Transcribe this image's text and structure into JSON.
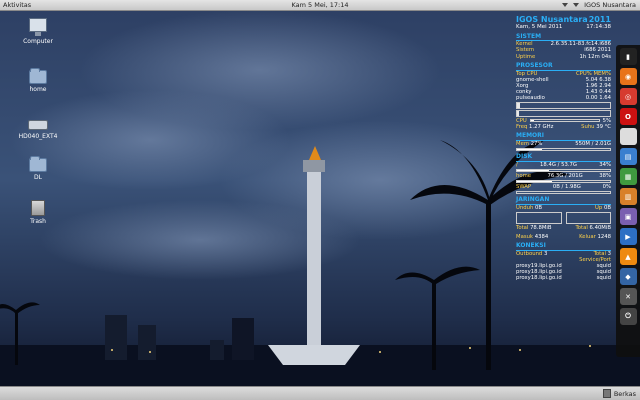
{
  "top_panel": {
    "menu_label": "Aktivitas",
    "clock": "Kam 5 Mei, 17:14",
    "user": "IGOS Nusantara"
  },
  "desktop_icons": [
    {
      "label": "Computer",
      "icon": "computer-icon"
    },
    {
      "label": "home",
      "icon": "folder-home-icon"
    },
    {
      "label": "HD040_EXT4",
      "icon": "drive-icon"
    },
    {
      "label": "DL",
      "icon": "folder-icon"
    },
    {
      "label": "Trash",
      "icon": "trash-icon"
    }
  ],
  "conky": {
    "title": "IGOS Nusantara",
    "year": "2011",
    "date": "Kam, 5 Mei 2011",
    "time": "17:14:38",
    "sistem_label": "SISTEM",
    "sistem": [
      {
        "k": "Kernel",
        "v": "2.6.35.11-83.fc14.i686"
      },
      {
        "k": "Sistem",
        "v": "i686 2011"
      },
      {
        "k": "Uptime",
        "v": "1h 12m 04s"
      }
    ],
    "prosesor_label": "PROSESOR",
    "proc_header": [
      "Top CPU",
      "CPU% MEM%"
    ],
    "procs": [
      {
        "k": "gnome-shell",
        "v": "5.04  6.38"
      },
      {
        "k": "Xorg",
        "v": "1.96  2.94"
      },
      {
        "k": "conky",
        "v": "1.43  0.44"
      },
      {
        "k": "pulseaudio",
        "v": "0.00  1.64"
      }
    ],
    "cpu_percent": 5,
    "cpu_label": "CPU",
    "cpu_value": "5%",
    "freq_label": "Freq",
    "freq_value": "1.27 GHz",
    "suhu_label": "Suhu",
    "suhu_value": "39 °C",
    "memori_label": "MEMORI",
    "mem_label": "Mem",
    "mem_percent_text": "27%",
    "mem_value": "550M / 2.01G",
    "mem_percent": 27,
    "disk_label": "DISK",
    "disks": [
      {
        "k": "/",
        "v": "18.4G / 53.7G",
        "pct": "34%",
        "fill": 34
      },
      {
        "k": "home",
        "v": "76.3G / 201G",
        "pct": "38%",
        "fill": 38
      },
      {
        "k": "SWAP",
        "v": "0B / 1.98G",
        "pct": "0%",
        "fill": 0
      }
    ],
    "jaringan_label": "JARINGAN",
    "down_label": "Unduh",
    "down_value": "0B",
    "up_label": "Up",
    "up_value": "0B",
    "total_down_label": "Total",
    "total_down": "78.8MiB",
    "total_up_label": "Total",
    "total_up": "6.40MiB",
    "masuk_label": "Masuk",
    "masuk_value": "4384",
    "keluar_label": "Keluar",
    "keluar_value": "1248",
    "koneksi_label": "KONEKSI",
    "outbound_label": "Outbound",
    "outbound_value": "3",
    "total_label": "Total",
    "total_value": "3",
    "service_label": "Service/Port",
    "connections": [
      {
        "host": "proxy19.lipi.go.id",
        "port": "squid"
      },
      {
        "host": "proxy18.lipi.go.id",
        "port": "squid"
      },
      {
        "host": "proxy18.lipi.go.id",
        "port": "squid"
      }
    ]
  },
  "dock": [
    {
      "name": "terminal-icon",
      "color": "#222222",
      "glyph": "▮"
    },
    {
      "name": "firefox-icon",
      "color": "#e8731a",
      "glyph": "◉"
    },
    {
      "name": "chrome-icon",
      "color": "#d63b2f",
      "glyph": "◎"
    },
    {
      "name": "opera-icon",
      "color": "#cc1111",
      "glyph": "O"
    },
    {
      "name": "blank-app-icon",
      "color": "#dddddd",
      "glyph": " "
    },
    {
      "name": "document-icon",
      "color": "#3a7fcf",
      "glyph": "▤"
    },
    {
      "name": "spreadsheet-icon",
      "color": "#3f9a3f",
      "glyph": "▦"
    },
    {
      "name": "presentation-icon",
      "color": "#d8802a",
      "glyph": "▥"
    },
    {
      "name": "image-viewer-icon",
      "color": "#7a5fb0",
      "glyph": "▣"
    },
    {
      "name": "media-player-icon",
      "color": "#2d6fc4",
      "glyph": "▶"
    },
    {
      "name": "vlc-icon",
      "color": "#ee8a10",
      "glyph": "▲"
    },
    {
      "name": "virtualbox-icon",
      "color": "#3465a4",
      "glyph": "◆"
    },
    {
      "name": "settings-tools-icon",
      "color": "#555555",
      "glyph": "✕"
    },
    {
      "name": "power-icon",
      "color": "#444444",
      "glyph": "⏻"
    }
  ],
  "bottom_panel": {
    "trash_label": "Berkas"
  }
}
